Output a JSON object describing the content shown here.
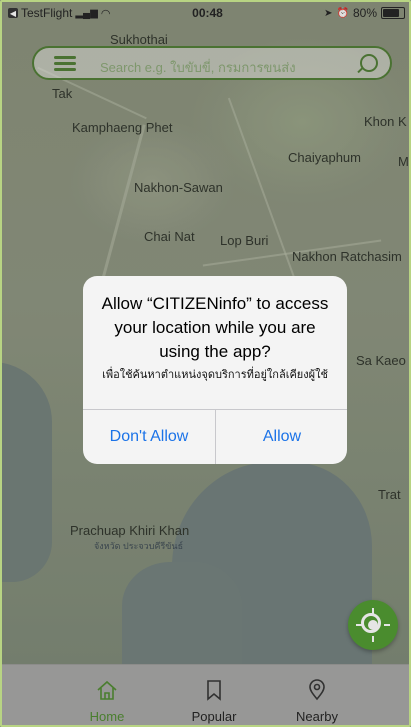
{
  "status_bar": {
    "carrier": "TestFlight",
    "time": "00:48",
    "battery": "80%"
  },
  "search": {
    "placeholder": "Search e.g. ใบขับขี่, กรมการขนส่ง"
  },
  "map": {
    "places": [
      {
        "name": "Sukhothai"
      },
      {
        "name": "Tak"
      },
      {
        "name": "Kamphaeng Phet"
      },
      {
        "name": "Khon K"
      },
      {
        "name": "Chaiyaphum"
      },
      {
        "name": "M"
      },
      {
        "name": "Nakhon-Sawan"
      },
      {
        "name": "Chai Nat"
      },
      {
        "name": "Lop Buri"
      },
      {
        "name": "Nakhon Ratchasim"
      },
      {
        "name": "Sa Kaeo"
      },
      {
        "name": "Trat"
      },
      {
        "name": "Prachuap Khiri Khan"
      },
      {
        "name": "จังหวัด ประจวบคีรีขันธ์"
      }
    ]
  },
  "dialog": {
    "title": "Allow “CITIZENinfo” to access your location while you are using the app?",
    "message": "เพื่อใช้ค้นหาตำแหน่งจุดบริการที่อยู่ใกล้เคียงผู้ใช้",
    "deny_label": "Don't Allow",
    "allow_label": "Allow"
  },
  "tabs": [
    {
      "label": "Home",
      "icon": "home-icon",
      "active": true
    },
    {
      "label": "Popular",
      "icon": "bookmark-icon",
      "active": false
    },
    {
      "label": "Nearby",
      "icon": "location-pin-icon",
      "active": false
    }
  ],
  "colors": {
    "accent": "#4f8a30",
    "ios_blue": "#1b73e8"
  }
}
